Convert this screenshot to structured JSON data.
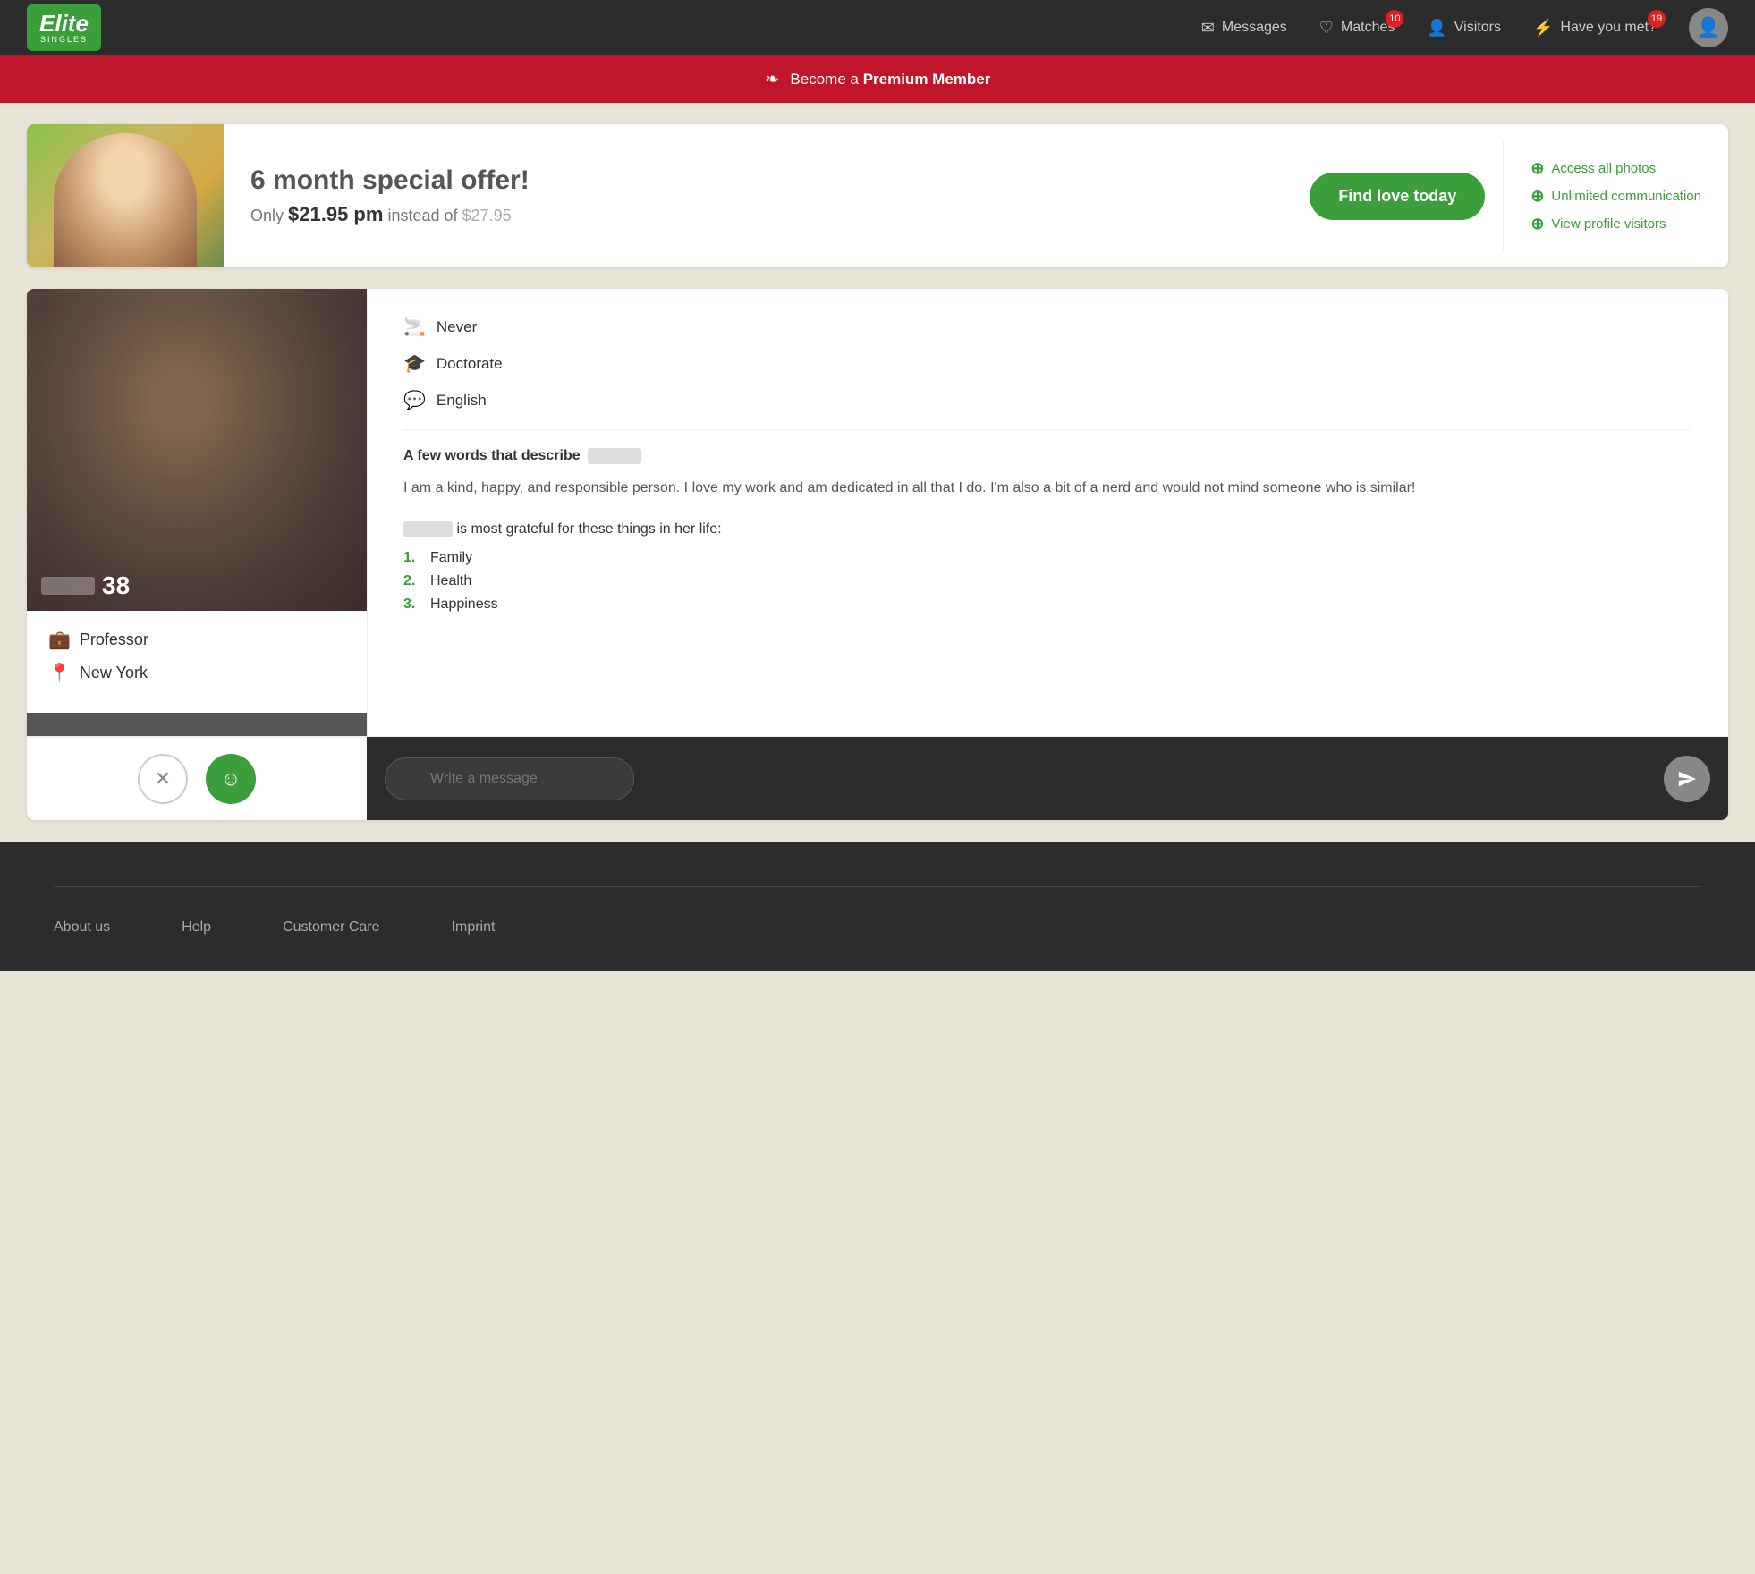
{
  "header": {
    "logo": "Elite",
    "logo_sub": "SINGLES",
    "nav": {
      "messages_label": "Messages",
      "matches_label": "Matches",
      "matches_badge": "10",
      "visitors_label": "Visitors",
      "have_you_met_label": "Have you met?",
      "have_you_met_badge": "19"
    }
  },
  "premium_banner": {
    "text": "Become a",
    "bold_text": "Premium Member"
  },
  "offer": {
    "title": "6 month special offer!",
    "price_label": "Only",
    "price": "$21.95 pm",
    "instead_label": "instead of",
    "old_price": "$27.95",
    "cta": "Find love today",
    "features": [
      "Access all photos",
      "Unlimited communication",
      "View profile visitors"
    ]
  },
  "profile": {
    "age": "38",
    "occupation": "Professor",
    "location": "New York",
    "smoking": "Never",
    "education": "Doctorate",
    "language": "English",
    "describe_title": "A few words that describe",
    "bio": "I am a kind, happy, and responsible person. I love my work and am dedicated in all that I do. I'm also a bit of a nerd and would not mind someone who is similar!",
    "grateful_title": "is most grateful for these things in her life:",
    "grateful_items": [
      "Family",
      "Health",
      "Happiness"
    ]
  },
  "actions": {
    "message_placeholder": "Write a message"
  },
  "footer": {
    "about_us": "About us",
    "help": "Help",
    "customer_care": "Customer Care",
    "imprint": "Imprint"
  }
}
